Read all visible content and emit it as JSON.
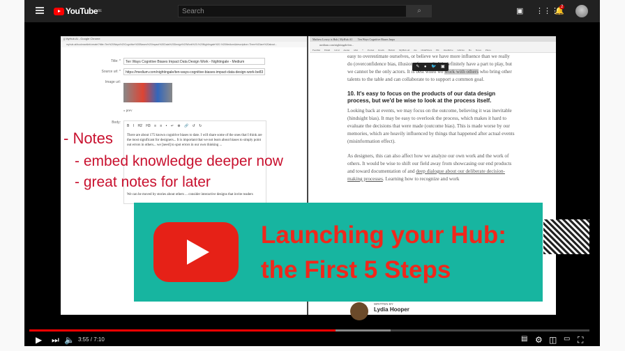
{
  "header": {
    "logo": "YouTube",
    "region": "BE",
    "search_placeholder": "Search",
    "notifications": "2",
    "icons": [
      "menu-icon",
      "create-video-icon",
      "apps-icon",
      "bell-icon",
      "avatar"
    ]
  },
  "video": {
    "left_window": {
      "title": "|| MyHub.AI - Google Chrome",
      "url": "myhub.ai/bookmarklet/create/?title=Ten%20Ways%20Cognitive%20Biases%20Impact%20Data%20Design%20Work%20-%20Nightingale%20-%20Medium&description=There%20are%20about...",
      "title_label": "Title: *",
      "title_value": "Ten Ways Cognitive Biases Impact Data Design Work - Nightingale - Medium",
      "source_label": "Source url: *",
      "source_value": "https://medium.com/nightingale/ten-ways-cognitive-biases-impact-data-design-work-be83",
      "image_label": "Image url:",
      "prev": "« prev",
      "body_label": "Body:",
      "toolbar": "B I H2 H3 ≡ ≡ • ↵ ⊕ 🔗 ↺ ↻",
      "body_p1": "There are about 175 known cognitive biases to date. I will share some of the ones that I think are the most significant for designers... It is important that we not learn about biases to simply point out errors in others... we [need] to spot errors in our own thinking ...",
      "body_p2": "We can be moved by stories about others ... consider interactive designs that invite readers"
    },
    "overlay_notes": [
      "- Notes",
      "- embed knowledge deeper now",
      "- great notes for later"
    ],
    "right_window": {
      "tabs": [
        "Mathew Lowry is Hub | MyHub.AI",
        "Ten Ways Cognitive Biases Impa"
      ],
      "url": "medium.com/nightingale/ten...",
      "bookmarks": "Feedlist Email GCal Asana wiki + Pocket Roam Hub.ht MyHub.AI me OldeFilters HC OneDrive GDrive Bo Notes Photo",
      "p0a": "easy to overestimate ourselves, or believe we have more influence than we really do (overconfidence bias, illusion of control). We definitely have a part to play, but we cannot be the only actors. It is best when we ",
      "p0hl": "work with others",
      "p0b": " who bring other talents to the table and can collaborate to to support a common goal.",
      "heading": "10. It's easy to focus on the products of our data design process, but we'd be wise to look at the process itself.",
      "p1": "Looking back at events, we may focus on the outcome, believing it was inevitable (hindsight bias). It may be easy to overlook the process, which makes it hard to evaluate the decisions that were made (outcome bias). This is made worse by our memories, which are heavily influenced by things that happened after actual events (misinformation effect).",
      "p2a": "As designers, this can also affect how we analyze our own work and the work of others. It would be wise to shift our field away from showcasing our end products and toward documentation of and ",
      "p2link": "deep dialogue about our deliberate decision-making processes",
      "p2b": ". Learning how to recognize and work",
      "written_by": "WRITTEN BY",
      "author": "Lydia Hooper",
      "popup": "✎ ● 🐦 ▣"
    },
    "banner": {
      "line1": "Launching your Hub:",
      "line2": "the First 5 Steps",
      "color": "#17b5a0",
      "text_color": "#f0271b"
    }
  },
  "controls": {
    "current_time": "3:55",
    "duration": "7:10",
    "time_display": "3:55 / 7:10",
    "progress": 0.547,
    "buffered": 0.645
  }
}
